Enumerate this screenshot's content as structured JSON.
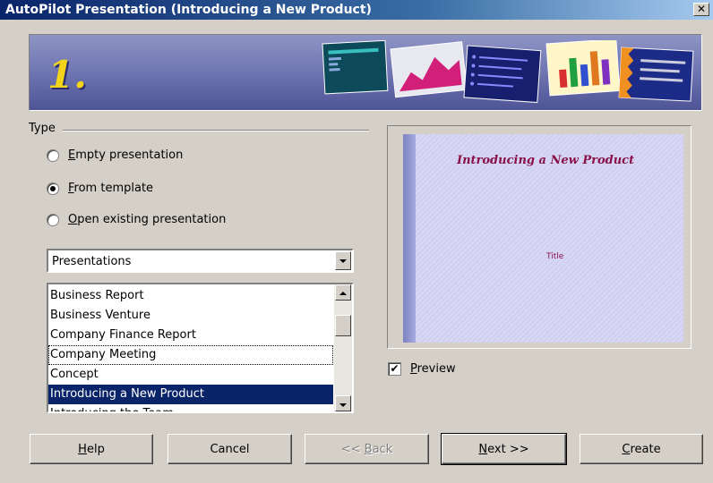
{
  "window": {
    "title": "AutoPilot Presentation (Introducing a New Product)",
    "close_glyph": "✕"
  },
  "banner": {
    "step": "1."
  },
  "type_group": {
    "label": "Type",
    "options": [
      {
        "label": "Empty presentation",
        "selected": false
      },
      {
        "label": "From template",
        "selected": true
      },
      {
        "label": "Open existing presentation",
        "selected": false
      }
    ]
  },
  "category_select": {
    "value": "Presentations"
  },
  "template_list": {
    "items": [
      "Business Report",
      "Business Venture",
      "Company Finance Report",
      "Company Meeting",
      "Concept",
      "Introducing a New Product",
      "Introducing the Team"
    ],
    "selected": "Introducing a New Product",
    "focused": "Company Meeting"
  },
  "preview": {
    "slide_title": "Introducing a New Product",
    "slide_subtitle": "Title",
    "checkbox_label": "Preview",
    "checked": true
  },
  "buttons": {
    "help": "Help",
    "cancel": "Cancel",
    "back": "<< Back",
    "next": "Next >>",
    "create": "Create"
  }
}
